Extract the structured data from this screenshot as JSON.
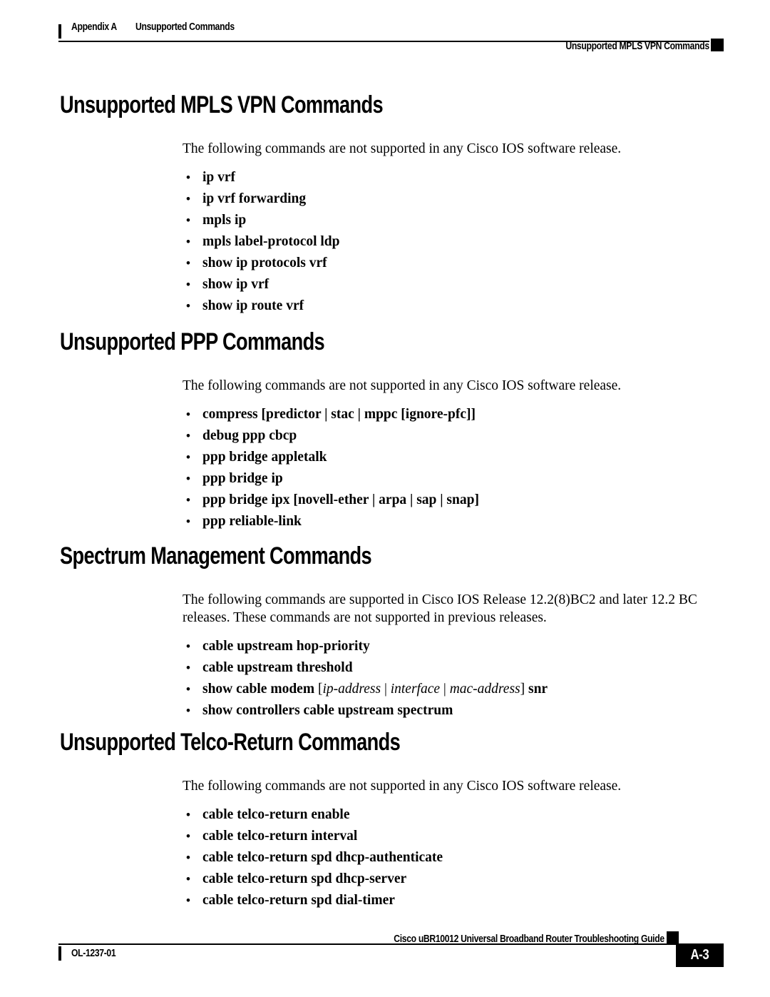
{
  "header": {
    "appendix": "Appendix A",
    "chapter_title": "Unsupported Commands",
    "running_head_right": "Unsupported MPLS VPN Commands"
  },
  "footer": {
    "doc_number": "OL-1237-01",
    "guide_title": "Cisco uBR10012 Universal Broadband Router Troubleshooting Guide",
    "page_number": "A-3"
  },
  "sections": [
    {
      "title": "Unsupported MPLS VPN Commands",
      "intro": "The following commands are not supported in any Cisco IOS software release.",
      "items": [
        "ip vrf",
        "ip vrf forwarding",
        "mpls ip",
        "mpls label-protocol ldp",
        "show ip protocols vrf",
        "show ip vrf",
        "show ip route vrf"
      ]
    },
    {
      "title": "Unsupported PPP Commands",
      "intro": "The following commands are not supported in any Cisco IOS software release.",
      "items": [
        "compress [predictor | stac | mppc [ignore-pfc]]",
        "debug ppp cbcp",
        "ppp bridge appletalk",
        "ppp bridge ip",
        "ppp bridge ipx [novell-ether | arpa | sap | snap]",
        "ppp reliable-link"
      ]
    },
    {
      "title": "Spectrum Management Commands",
      "intro": "The following commands are supported in Cisco IOS Release 12.2(8)BC2 and later 12.2 BC releases. These commands are not supported in previous releases.",
      "items": [
        "cable upstream hop-priority",
        "cable upstream threshold",
        "show cable modem [ip-address | interface | mac-address] snr",
        "show controllers cable upstream spectrum"
      ],
      "item_parts": {
        "2": [
          {
            "text": "show cable modem ",
            "style": "bold"
          },
          {
            "text": "[",
            "style": "plain"
          },
          {
            "text": "ip-address",
            "style": "italic"
          },
          {
            "text": " | ",
            "style": "plain"
          },
          {
            "text": "interface",
            "style": "italic"
          },
          {
            "text": " | ",
            "style": "plain"
          },
          {
            "text": "mac-address",
            "style": "italic"
          },
          {
            "text": "]",
            "style": "plain"
          },
          {
            "text": " snr",
            "style": "bold"
          }
        ]
      }
    },
    {
      "title": "Unsupported Telco-Return Commands",
      "intro": "The following commands are not supported in any Cisco IOS software release.",
      "items": [
        "cable telco-return enable",
        "cable telco-return interval",
        "cable telco-return spd dhcp-authenticate",
        "cable telco-return spd dhcp-server",
        "cable telco-return spd dial-timer"
      ]
    }
  ]
}
